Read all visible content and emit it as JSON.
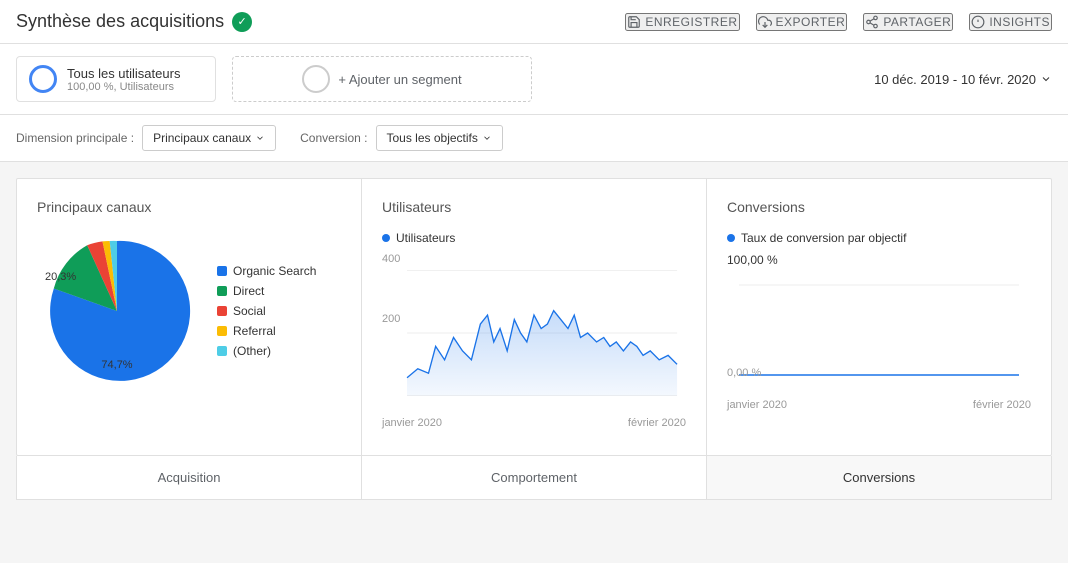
{
  "header": {
    "title": "Synthèse des acquisitions",
    "actions": [
      {
        "id": "save",
        "label": "ENREGISTRER",
        "icon": "save-icon"
      },
      {
        "id": "export",
        "label": "EXPORTER",
        "icon": "export-icon"
      },
      {
        "id": "share",
        "label": "PARTAGER",
        "icon": "share-icon"
      },
      {
        "id": "insights",
        "label": "INSIGHTS",
        "icon": "insights-icon"
      }
    ]
  },
  "segment": {
    "name": "Tous les utilisateurs",
    "sub": "100,00 %, Utilisateurs",
    "add_label": "+ Ajouter un segment"
  },
  "date_range": {
    "label": "10 déc. 2019 - 10 févr. 2020"
  },
  "filters": {
    "dimension_label": "Dimension principale :",
    "dimension_value": "Principaux canaux",
    "conversion_label": "Conversion :",
    "conversion_value": "Tous les objectifs"
  },
  "charts": {
    "pie": {
      "title": "Principaux canaux",
      "segments": [
        {
          "name": "Organic Search",
          "color": "#1a73e8",
          "pct": 74.7,
          "startAngle": 0
        },
        {
          "name": "Direct",
          "color": "#0f9d58",
          "pct": 20.3
        },
        {
          "name": "Social",
          "color": "#ea4335",
          "pct": 2.8
        },
        {
          "name": "Referral",
          "color": "#fbbc04",
          "pct": 1.2
        },
        {
          "name": "(Other)",
          "color": "#4ecde6",
          "pct": 1.0
        }
      ],
      "label_747": "74,7%",
      "label_203": "20,3%"
    },
    "users": {
      "title": "Utilisateurs",
      "legend_label": "Utilisateurs",
      "legend_color": "#1a73e8",
      "y_labels": [
        "400",
        "200"
      ],
      "x_labels": [
        "janvier 2020",
        "février 2020"
      ]
    },
    "conversions": {
      "title": "Conversions",
      "legend_label": "Taux de conversion par objectif",
      "legend_color": "#1a73e8",
      "top_pct": "100,00 %",
      "bottom_pct": "0,00 %",
      "x_labels": [
        "janvier 2020",
        "février 2020"
      ]
    }
  },
  "bottom_tabs": [
    {
      "label": "Acquisition",
      "highlighted": false
    },
    {
      "label": "Comportement",
      "highlighted": false
    },
    {
      "label": "Conversions",
      "highlighted": true
    }
  ]
}
